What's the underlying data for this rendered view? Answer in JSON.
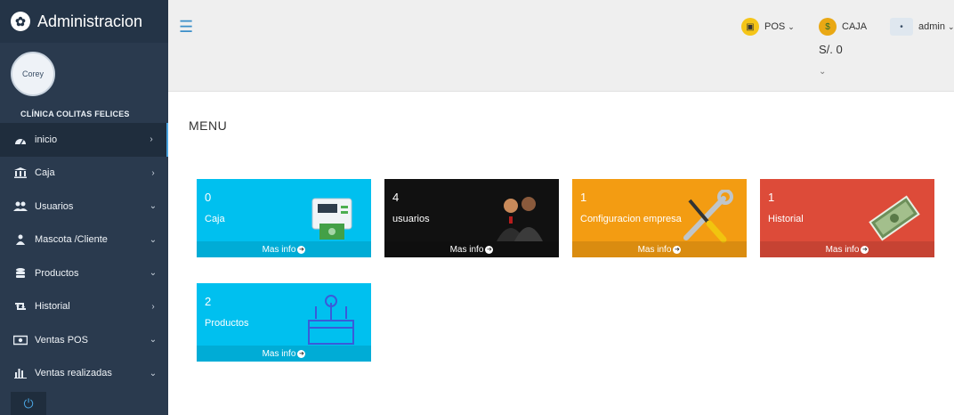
{
  "sidebar": {
    "title": "Administracion",
    "clinic": "CLÍNICA COLITAS FELICES",
    "avatar_text": "Corey",
    "items": [
      {
        "label": "inicio",
        "icon": "dashboard-icon",
        "arrow": "›"
      },
      {
        "label": "Caja",
        "icon": "bank-icon",
        "arrow": "›"
      },
      {
        "label": "Usuarios",
        "icon": "users-icon",
        "arrow": "⌄"
      },
      {
        "label": "Mascota /Cliente",
        "icon": "pet-icon",
        "arrow": "⌄"
      },
      {
        "label": "Productos",
        "icon": "database-icon",
        "arrow": "⌄"
      },
      {
        "label": "Historial",
        "icon": "retweet-icon",
        "arrow": "›"
      },
      {
        "label": "Ventas POS",
        "icon": "money-icon",
        "arrow": "⌄"
      },
      {
        "label": "Ventas realizadas",
        "icon": "bar-chart-icon",
        "arrow": "⌄"
      }
    ]
  },
  "topbar": {
    "pos_label": "POS",
    "caja_label": "CAJA",
    "caja_value": "S/. 0",
    "admin_label": "admin"
  },
  "page": {
    "title": "MENU"
  },
  "tiles": [
    {
      "value": "0",
      "label": "Caja",
      "footer": "Mas info",
      "color": "#00c0ef"
    },
    {
      "value": "4",
      "label": "usuarios",
      "footer": "Mas info",
      "color": "#111111"
    },
    {
      "value": "1",
      "label": "Configuracion empresa",
      "footer": "Mas info",
      "color": "#f39c12"
    },
    {
      "value": "1",
      "label": "Historial",
      "footer": "Mas info",
      "color": "#dd4b39"
    },
    {
      "value": "2",
      "label": "Productos",
      "footer": "Mas info",
      "color": "#00c0ef"
    }
  ]
}
